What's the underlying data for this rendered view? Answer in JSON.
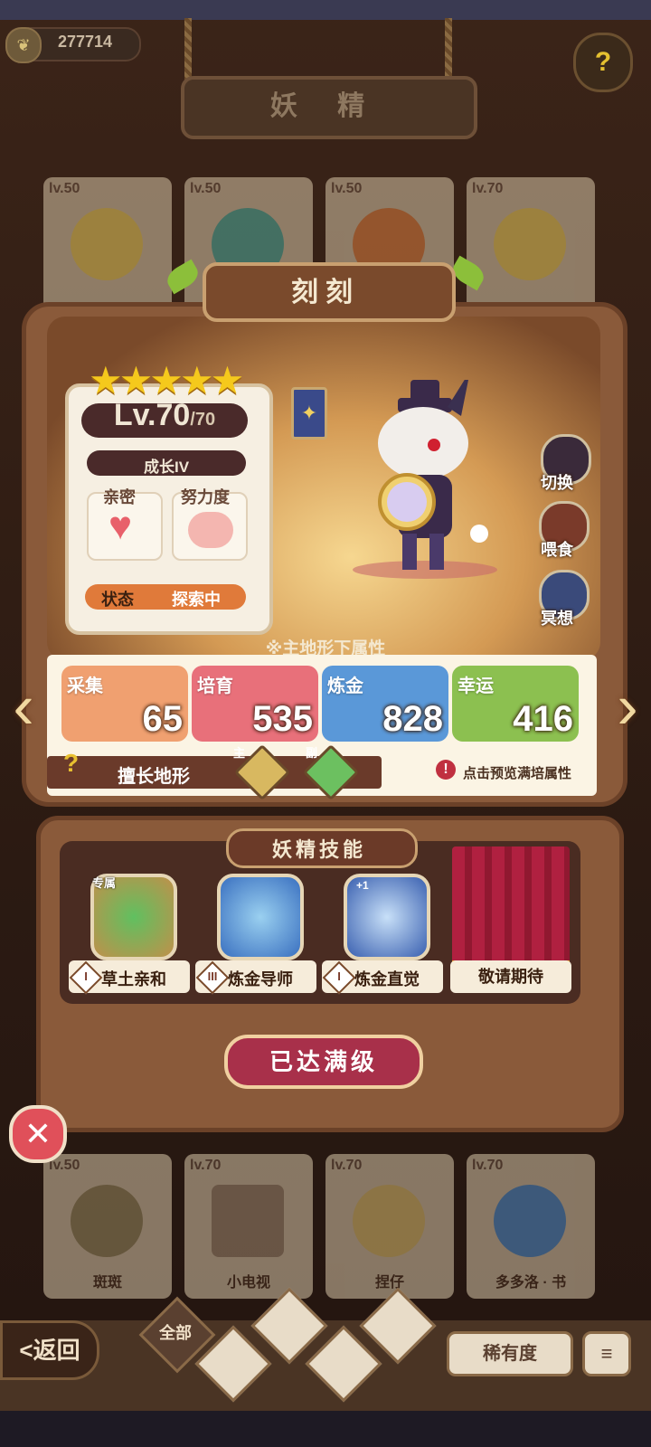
{
  "currency": {
    "amount": "277714",
    "icon": "leaf-coin-icon"
  },
  "header": {
    "title": "妖 精",
    "help_icon": "?"
  },
  "bg_cards_top": [
    {
      "level": "lv.50"
    },
    {
      "level": "lv.50"
    },
    {
      "level": "lv.50"
    },
    {
      "level": "lv.70"
    }
  ],
  "bg_cards_bottom": [
    {
      "level": "lv.50",
      "name": "斑斑"
    },
    {
      "level": "lv.70",
      "name": "小电视"
    },
    {
      "level": "lv.70",
      "name": "捏仔"
    },
    {
      "level": "lv.70",
      "name": "多多洛 · 书"
    }
  ],
  "fairy": {
    "name": "刻刻",
    "stars": "★★★★★",
    "level_current": "Lv.70",
    "level_max": "/70",
    "growth": "成长IV",
    "intimacy_label": "亲密",
    "effort_label": "努力度",
    "status_label": "状态",
    "status_value": "探索中"
  },
  "side_buttons": {
    "switch": "切换",
    "feed": "喂食",
    "meditate": "冥想"
  },
  "attributes": {
    "title": "※主地形下属性",
    "stats": [
      {
        "name": "采集",
        "value": "65",
        "color": "#f0a070"
      },
      {
        "name": "培育",
        "value": "535",
        "color": "#e8707a"
      },
      {
        "name": "炼金",
        "value": "828",
        "color": "#5a98d8"
      },
      {
        "name": "幸运",
        "value": "416",
        "color": "#8cc050"
      }
    ],
    "terrain_label": "擅长地形",
    "main_tag": "主",
    "sub_tag": "副",
    "preview_text": "点击预览满培属性",
    "preview_icon": "!"
  },
  "skills": {
    "title": "妖精技能",
    "exclusive_tag": "专属",
    "items": [
      {
        "rank": "I",
        "name": "草土亲和"
      },
      {
        "rank": "III",
        "name": "炼金导师"
      },
      {
        "rank": "I",
        "name": "炼金直觉"
      }
    ],
    "coming_soon": "敬请期待",
    "plus_one": "+1"
  },
  "max_button": "已达满级",
  "close_icon": "✕",
  "bottom_nav": {
    "back": "<返回",
    "all": "全部",
    "rarity": "稀有度",
    "sort_icon": "≡"
  },
  "colors": {
    "accent_red": "#a8304a",
    "panel_brown": "#8a5a3a"
  }
}
